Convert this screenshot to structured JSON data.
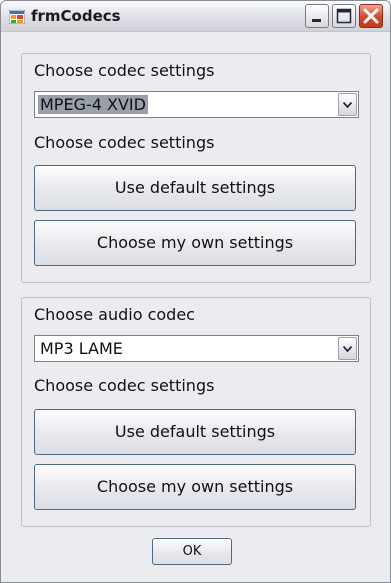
{
  "window": {
    "title": "frmCodecs"
  },
  "title_bar": {
    "app_icon": "windows-form-icon",
    "minimize_icon": "minimize-icon",
    "maximize_icon": "maximize-icon",
    "close_icon": "close-icon"
  },
  "video_group": {
    "label": "Choose codec settings",
    "codec_selected": "MPEG-4 XVID",
    "settings_label": "Choose codec settings",
    "default_button": "Use default settings",
    "own_button": "Choose my own settings"
  },
  "audio_group": {
    "label": "Choose audio codec",
    "codec_selected": "MP3 LAME",
    "settings_label": "Choose codec settings",
    "default_button": "Use default settings",
    "own_button": "Choose my own settings"
  },
  "ok_button": "OK",
  "colors": {
    "window_bg": "#ecebf0",
    "close_button": "#d04a2c",
    "selection_highlight": "#9aa0aa",
    "button_border": "#4e6a82"
  }
}
